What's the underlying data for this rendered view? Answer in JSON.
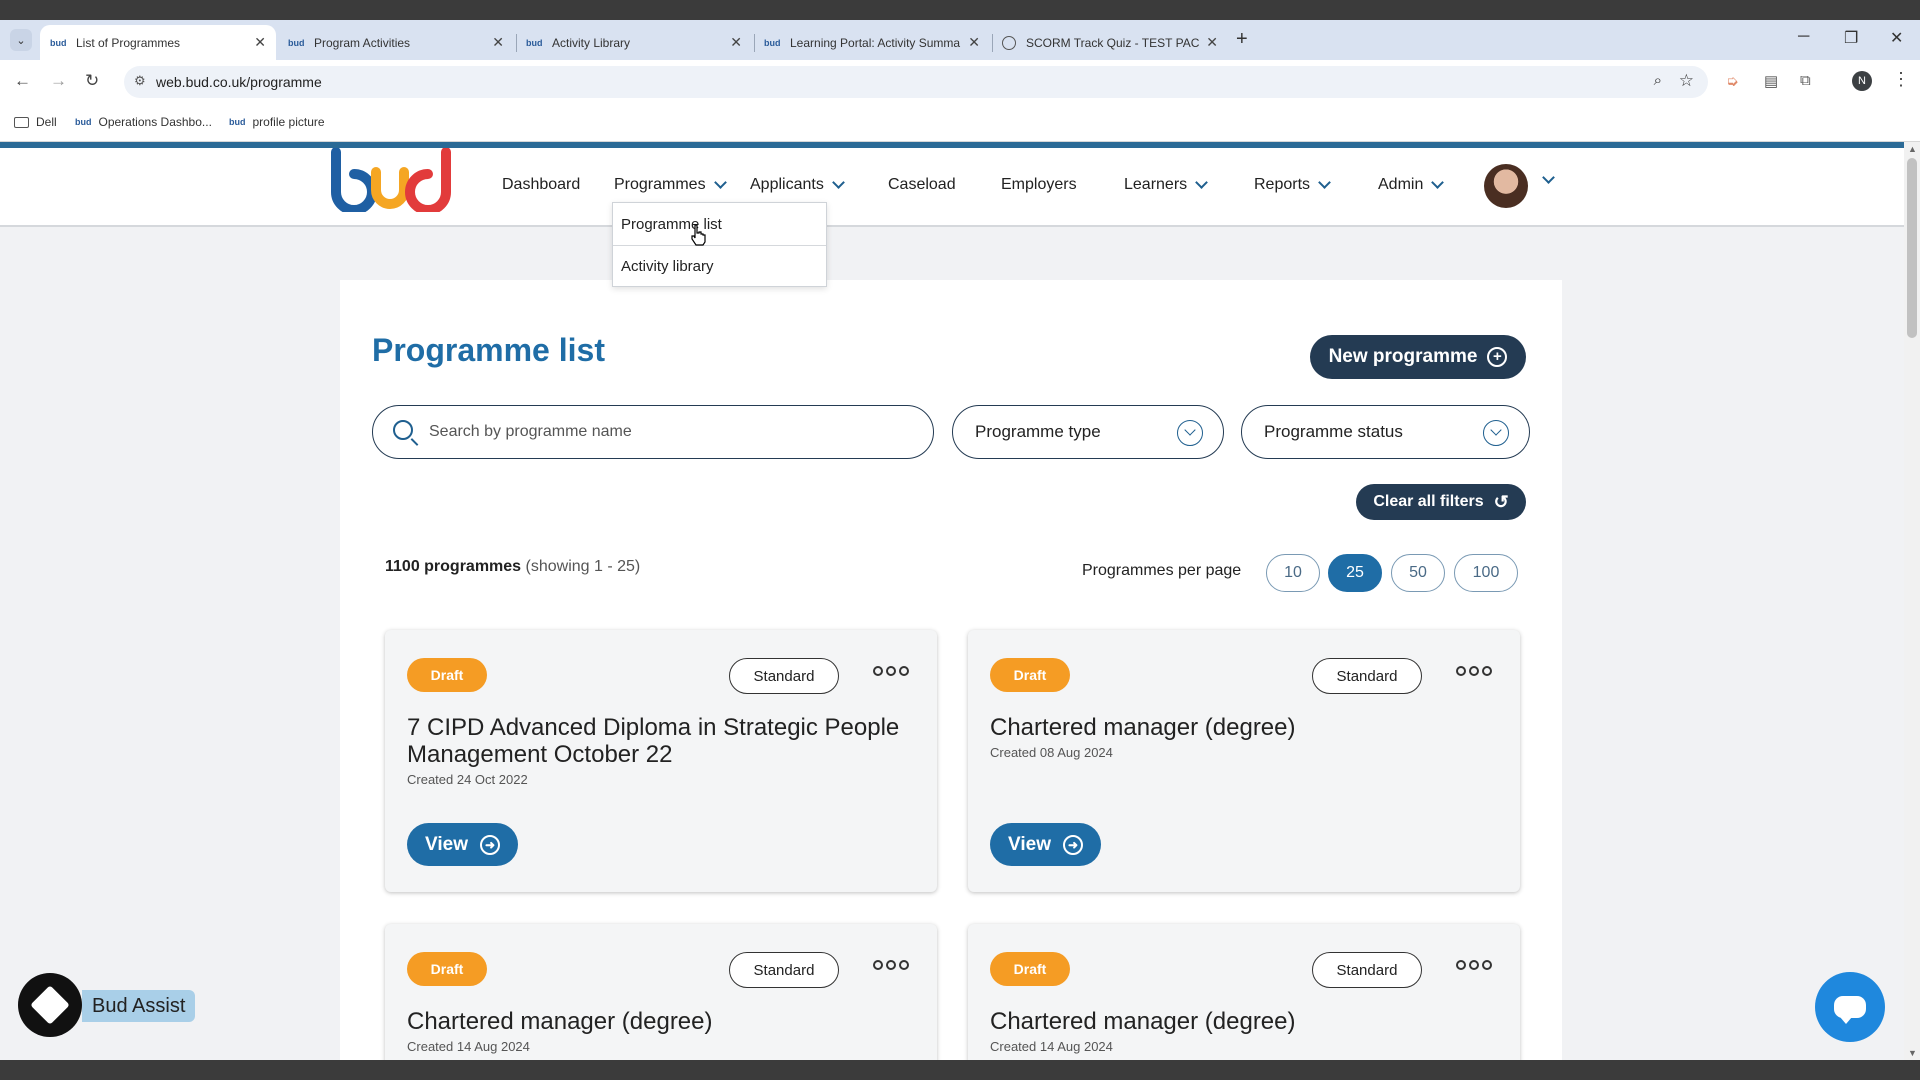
{
  "browser": {
    "tabs": [
      {
        "title": "List of Programmes",
        "favicon": "bud"
      },
      {
        "title": "Program Activities",
        "favicon": "bud"
      },
      {
        "title": "Activity Library",
        "favicon": "bud"
      },
      {
        "title": "Learning Portal: Activity Summa",
        "favicon": "bud"
      },
      {
        "title": "SCORM Track Quiz - TEST PACK",
        "favicon": "globe"
      }
    ],
    "url": "web.bud.co.uk/programme",
    "profile_initial": "N",
    "bookmarks": [
      "Dell",
      "Operations Dashbo...",
      "profile picture"
    ]
  },
  "nav": {
    "items": [
      "Dashboard",
      "Programmes",
      "Applicants",
      "Caseload",
      "Employers",
      "Learners",
      "Reports",
      "Admin"
    ],
    "dropdown": [
      "Programme list",
      "Activity library"
    ]
  },
  "main": {
    "title": "Programme list",
    "new_button": "New programme",
    "search_placeholder": "Search by programme name",
    "filter_type": "Programme type",
    "filter_status": "Programme status",
    "clear_button": "Clear all filters",
    "count_bold": "1100 programmes",
    "count_light": "(showing 1 - 25)",
    "per_page_label": "Programmes per page",
    "per_page_options": [
      "10",
      "25",
      "50",
      "100"
    ],
    "per_page_selected": "25"
  },
  "programmes": [
    {
      "status": "Draft",
      "type": "Standard",
      "title": "7 CIPD Advanced Diploma in Strategic People Management October 22",
      "created": "Created 24 Oct 2022",
      "view": "View"
    },
    {
      "status": "Draft",
      "type": "Standard",
      "title": "Chartered manager (degree)",
      "created": "Created 08 Aug 2024",
      "view": "View"
    },
    {
      "status": "Draft",
      "type": "Standard",
      "title": "Chartered manager (degree)",
      "created": "Created 14 Aug 2024"
    },
    {
      "status": "Draft",
      "type": "Standard",
      "title": "Chartered manager (degree)",
      "created": "Created 14 Aug 2024"
    }
  ],
  "assist": {
    "label": "Bud Assist"
  },
  "colors": {
    "brand_blue": "#1f6da6",
    "dark_navy": "#243b53",
    "draft_orange": "#f59c24"
  }
}
